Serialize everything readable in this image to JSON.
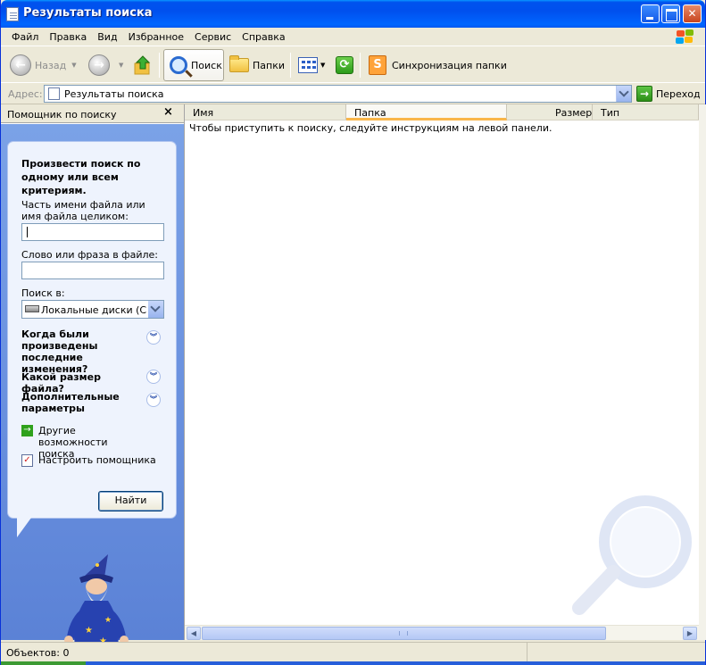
{
  "window": {
    "title": "Результаты поиска"
  },
  "menu": {
    "items": [
      "Файл",
      "Правка",
      "Вид",
      "Избранное",
      "Сервис",
      "Справка"
    ]
  },
  "toolbar": {
    "back_label": "Назад",
    "search_label": "Поиск",
    "folders_label": "Папки",
    "sync_label": "Синхронизация папки"
  },
  "address": {
    "label": "Адрес:",
    "value": "Результаты поиска",
    "go_label": "Переход"
  },
  "search_pane": {
    "header": "Помощник по поиску",
    "close": "×",
    "heading": "Произвести поиск по одному или всем критериям.",
    "filename_label": "Часть имени файла или имя файла целиком:",
    "filename_value": "",
    "phrase_label": "Слово или фраза в файле:",
    "phrase_value": "",
    "lookin_label": "Поиск в:",
    "lookin_value": "Локальные диски (C:;D",
    "section_modified": "Когда были произведены последние изменения?",
    "section_size": "Какой размер файла?",
    "section_advanced": "Дополнительные параметры",
    "link_other": "Другие возможности поиска",
    "link_customize": "Настроить помощника",
    "find_button": "Найти"
  },
  "results": {
    "columns": [
      "Имя",
      "Папка",
      "Размер",
      "Тип"
    ],
    "message": "Чтобы приступить к поиску, следуйте инструкциям на левой панели."
  },
  "status": {
    "text": "Объектов: 0"
  },
  "colors": {
    "titlebar": "#0053ee",
    "pane_blue": "#6e95e1",
    "sort_highlight": "#f9b64a"
  }
}
